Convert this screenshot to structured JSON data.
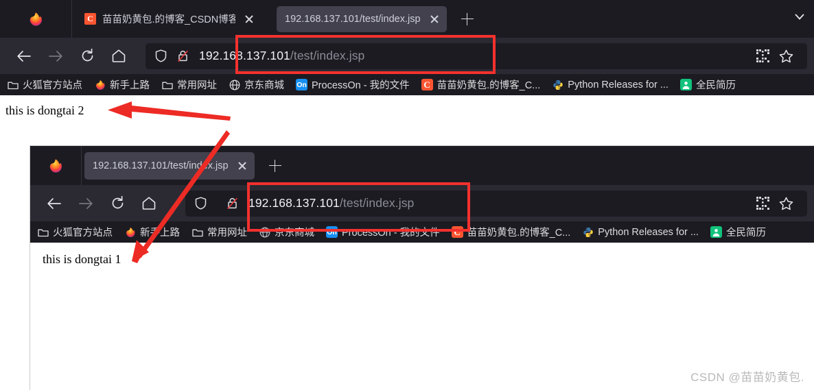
{
  "outer_window": {
    "tabs": [
      {
        "title": "苗苗奶黄包.的博客_CSDN博客",
        "favicon": "csdn-icon",
        "active": false,
        "close_label": "×"
      },
      {
        "title": "192.168.137.101/test/index.jsp",
        "favicon": "none",
        "active": true,
        "close_label": "×"
      }
    ],
    "new_tab_label": "+",
    "toolbar": {
      "back": "back-arrow-icon",
      "forward": "forward-arrow-icon",
      "reload": "reload-icon",
      "home": "home-icon"
    },
    "urlbar": {
      "shield_icon": "shield-icon",
      "lock_icon": "lock-crossed-out-icon",
      "url_host": "192.168.137.101",
      "url_path": "/test/index.jsp",
      "qr_icon": "qr-code-icon",
      "bookmark_icon": "star-icon"
    },
    "bookmarks": [
      {
        "label": "火狐官方站点",
        "icon": "folder-icon"
      },
      {
        "label": "新手上路",
        "icon": "firefox-icon"
      },
      {
        "label": "常用网址",
        "icon": "folder-icon"
      },
      {
        "label": "京东商城",
        "icon": "globe-icon"
      },
      {
        "label": "ProcessOn - 我的文件",
        "icon": "on-icon",
        "icon_text": "On"
      },
      {
        "label": "苗苗奶黄包.的博客_C...",
        "icon": "csdn-icon",
        "icon_text": "C"
      },
      {
        "label": "Python Releases for ...",
        "icon": "python-icon"
      },
      {
        "label": "全民简历",
        "icon": "resume-icon"
      }
    ],
    "page_body": "this is dongtai 2"
  },
  "inner_window": {
    "tabs": [
      {
        "title": "192.168.137.101/test/index.jsp",
        "favicon": "none",
        "active": true,
        "close_label": "×"
      }
    ],
    "new_tab_label": "+",
    "urlbar": {
      "shield_icon": "shield-icon",
      "lock_icon": "lock-crossed-out-icon",
      "url_host": "192.168.137.101",
      "url_path": "/test/index.jsp",
      "qr_icon": "qr-code-icon",
      "bookmark_icon": "star-icon"
    },
    "bookmarks": [
      {
        "label": "火狐官方站点",
        "icon": "folder-icon"
      },
      {
        "label": "新手上路",
        "icon": "firefox-icon"
      },
      {
        "label": "常用网址",
        "icon": "folder-icon"
      },
      {
        "label": "京东商城",
        "icon": "globe-icon"
      },
      {
        "label": "ProcessOn - 我的文件",
        "icon": "on-icon",
        "icon_text": "On"
      },
      {
        "label": "苗苗奶黄包.的博客_C...",
        "icon": "csdn-icon",
        "icon_text": "C"
      },
      {
        "label": "Python Releases for ...",
        "icon": "python-icon"
      },
      {
        "label": "全民简历",
        "icon": "resume-icon"
      }
    ],
    "page_body": "this is dongtai 1"
  },
  "annotations": {
    "highlight_color": "#f4312e",
    "arrow_color": "#ed2b25",
    "arrow_to_dongtai2": "horizontal-left-arrow",
    "arrow_to_dongtai1": "diagonal-down-left-arrow"
  },
  "watermark": "CSDN @苗苗奶黄包."
}
